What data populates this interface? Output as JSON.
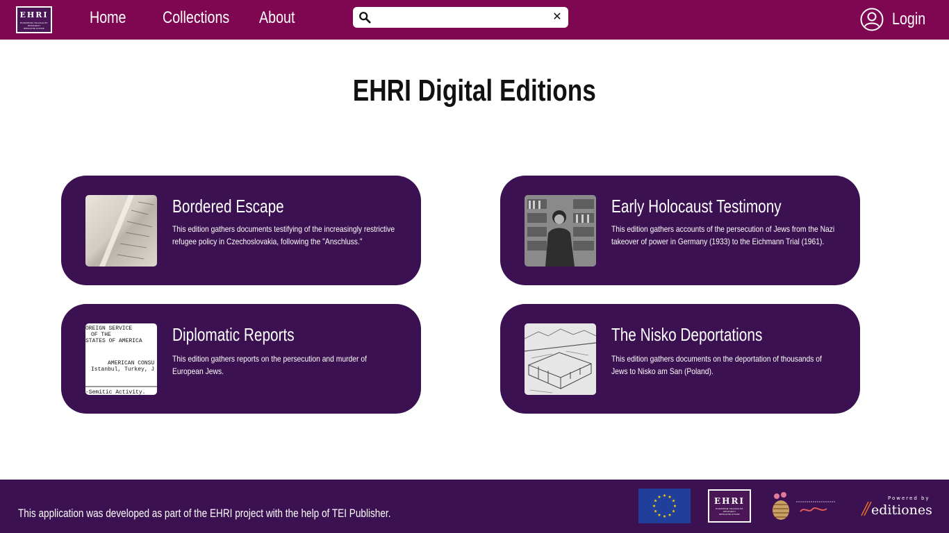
{
  "header": {
    "logo_text": "EHRI",
    "logo_subtext": "EUROPEAN HOLOCAUST RESEARCH INFRASTRUCTURE",
    "nav": {
      "home": "Home",
      "collections": "Collections",
      "about": "About"
    },
    "search": {
      "value": "",
      "placeholder": ""
    },
    "login_label": "Login"
  },
  "main": {
    "title": "EHRI Digital Editions",
    "editions": [
      {
        "title": "Bordered Escape",
        "description": "This edition gathers documents testifying of the increasingly restrictive refugee policy in Czechoslovakia, following the \"Anschluss.\""
      },
      {
        "title": "Early Holocaust Testimony",
        "description": "This edition gathers accounts of the persecution of Jews from the Nazi takeover of power in Germany (1933) to the Eichmann Trial (1961)."
      },
      {
        "title": "Diplomatic Reports",
        "description": "This edition gathers reports on the persecution and murder of European Jews.",
        "thumb_lines": [
          "OREIGN SERVICE",
          "OF THE",
          "STATES OF AMERICA",
          "AMERICAN CONSU",
          "Istanbul, Turkey, J",
          "-Semitic Activity."
        ]
      },
      {
        "title": "The Nisko Deportations",
        "description": "This edition gathers documents on the deportation of thousands of Jews to Nisko am San (Poland)."
      }
    ]
  },
  "footer": {
    "text": "This application was developed as part of the EHRI project with the help of TEI Publisher.",
    "powered_by": "Powered by",
    "editiones": "editiones"
  },
  "colors": {
    "header_bg": "#7f0752",
    "card_bg": "#3b1151",
    "footer_bg": "#3b1151",
    "text_light": "#ffffff"
  }
}
